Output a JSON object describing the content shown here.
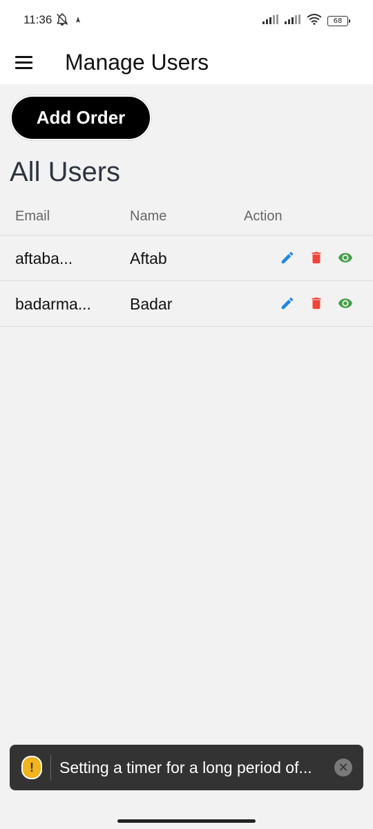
{
  "status_bar": {
    "time": "11:36",
    "battery": "68",
    "icons": [
      "notifications-off-icon",
      "location-icon",
      "signal-icon",
      "signal-icon",
      "wifi-icon",
      "battery-icon"
    ]
  },
  "app_bar": {
    "title": "Manage Users",
    "menu_icon": "menu-icon"
  },
  "actions": {
    "add_order_label": "Add Order"
  },
  "users_section": {
    "title": "All Users",
    "columns": [
      "Email",
      "Name",
      "Action"
    ],
    "rows": [
      {
        "email": "aftaba...",
        "name": "Aftab"
      },
      {
        "email": "badarma...",
        "name": "Badar"
      }
    ],
    "row_action_icons": [
      "edit-icon",
      "delete-icon",
      "view-icon"
    ]
  },
  "toast": {
    "message": "Setting a timer for a long period of...",
    "icon": "warning-icon",
    "close_icon": "close-icon"
  },
  "colors": {
    "edit": "#1e88e5",
    "delete": "#f44336",
    "view": "#43a047",
    "warning": "#f2b31c"
  }
}
